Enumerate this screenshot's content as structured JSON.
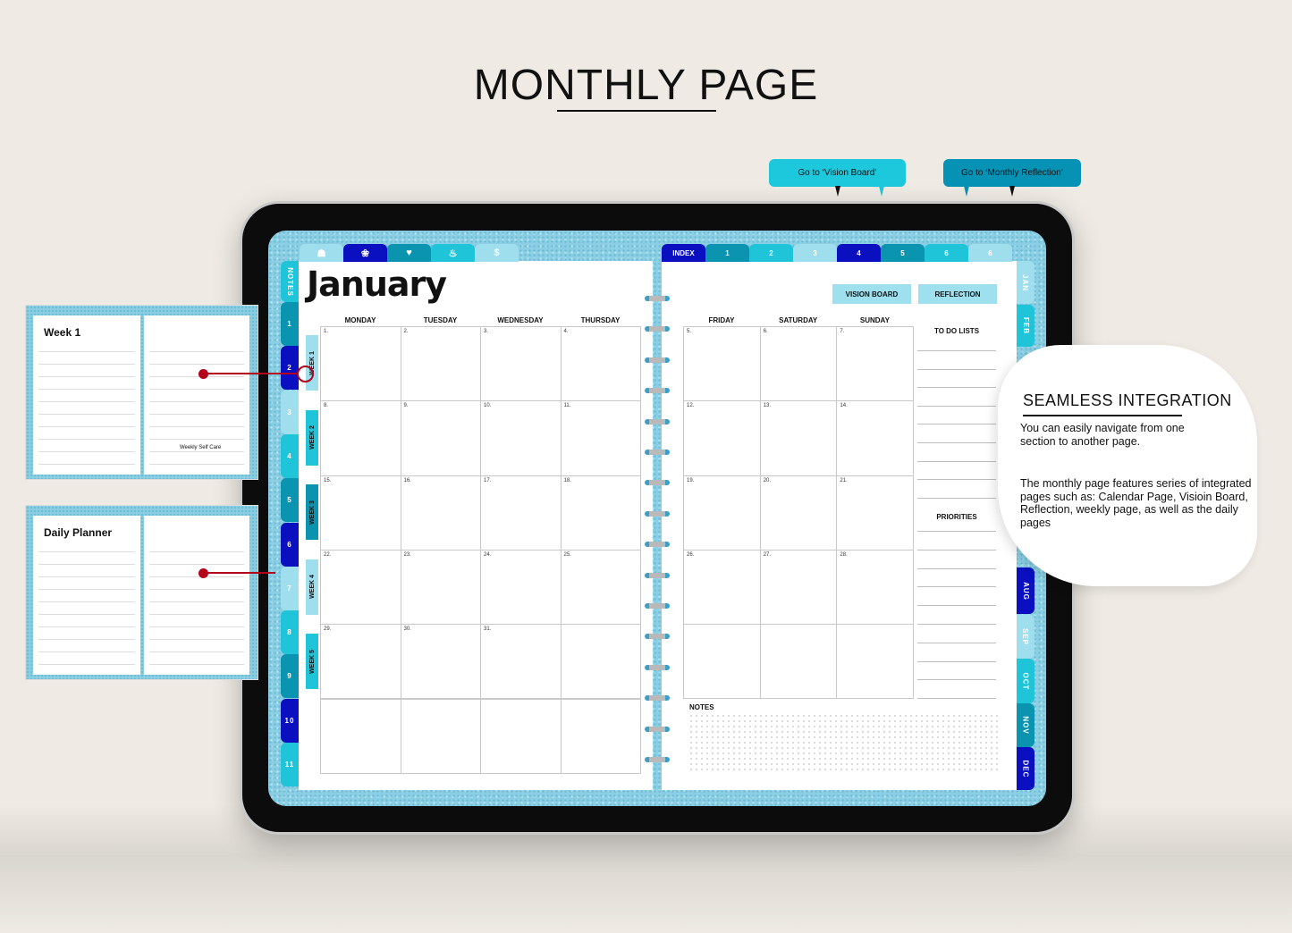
{
  "title": "MONTHLY PAGE",
  "bubbles": {
    "vision": "Go to ‘Vision Board’",
    "reflection": "Go to ‘Monthly Reflection’"
  },
  "colors": {
    "light": "#9fdeec",
    "cyan": "#20c4d8",
    "teal": "#0a94b0",
    "navy": "#0a0fc0",
    "red": "#b3001b"
  },
  "left_top_tabs": [
    {
      "icon": "bear-icon"
    },
    {
      "icon": "lotus-icon"
    },
    {
      "icon": "heart-pulse-icon"
    },
    {
      "icon": "food-icon"
    },
    {
      "icon": "dollar-icon"
    }
  ],
  "right_top_tabs": [
    "INDEX",
    "1",
    "2",
    "3",
    "4",
    "5",
    "6",
    "6"
  ],
  "left_side_tabs": [
    "NOTES",
    "1",
    "2",
    "3",
    "4",
    "5",
    "6",
    "7",
    "8",
    "9",
    "10",
    "11"
  ],
  "right_side_tabs": [
    "JAN",
    "FEB",
    "AUG",
    "SEP",
    "OCT",
    "NOV",
    "DEC"
  ],
  "month": "January",
  "days_left": [
    "MONDAY",
    "TUESDAY",
    "WEDNESDAY",
    "THURSDAY"
  ],
  "days_right": [
    "FRIDAY",
    "SATURDAY",
    "SUNDAY"
  ],
  "weeks": [
    "WEEK 1",
    "WEEK 2",
    "WEEK 3",
    "WEEK 4",
    "WEEK 5"
  ],
  "dates_left": [
    [
      "1.",
      "2.",
      "3.",
      "4."
    ],
    [
      "8.",
      "9.",
      "10.",
      "11."
    ],
    [
      "15.",
      "16.",
      "17.",
      "18."
    ],
    [
      "22.",
      "23.",
      "24.",
      "25."
    ],
    [
      "29.",
      "30.",
      "31.",
      ""
    ],
    [
      "",
      "",
      "",
      ""
    ]
  ],
  "dates_right": [
    [
      "5.",
      "6.",
      "7."
    ],
    [
      "12.",
      "13.",
      "14."
    ],
    [
      "19.",
      "20.",
      "21."
    ],
    [
      "26.",
      "27.",
      "28."
    ],
    [
      "",
      "",
      ""
    ]
  ],
  "buttons": {
    "vision_board": "VISION BOARD",
    "reflection": "REFLECTION"
  },
  "todo_label": "TO DO LISTS",
  "priorities_label": "PRIORITIES",
  "notes_label": "NOTES",
  "callout": {
    "heading": "SEAMLESS INTEGRATION",
    "p1": "You can easily navigate from one section to another page.",
    "p2": "The monthly page features series of integrated pages such as: Calendar Page, Visioin Board, Reflection, weekly page, as well as the daily pages"
  },
  "thumbs": {
    "weekly": "Week 1",
    "weekly_selfcare": "Weekly Self Care",
    "daily": "Daily Planner"
  }
}
